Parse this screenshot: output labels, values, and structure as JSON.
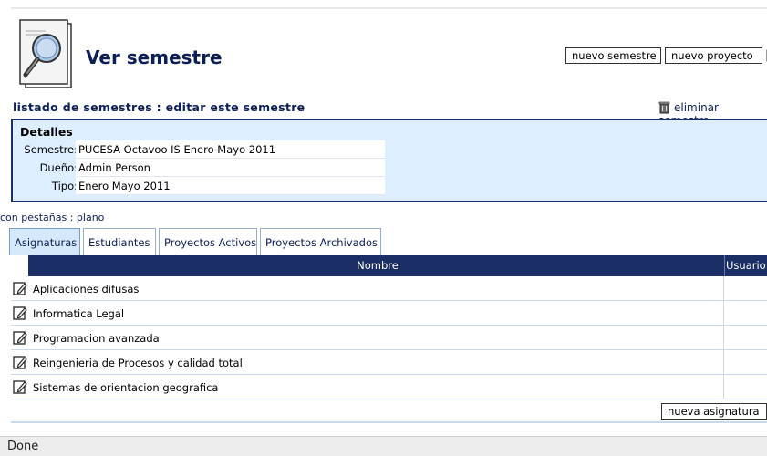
{
  "header": {
    "title": "Ver semestre",
    "icon": "document-magnifier-icon",
    "buttons": {
      "new_semester": "nuevo semestre",
      "new_project": "nuevo proyecto"
    }
  },
  "nav": {
    "breadcrumb": "listado de semestres : editar este semestre",
    "delete_link": "eliminar semestre"
  },
  "details": {
    "title": "Detalles",
    "rows": [
      {
        "label": "Semestre:",
        "value": "PUCESA Octavoo IS Enero Mayo 2011"
      },
      {
        "label": "Dueño:",
        "value": "Admin Person"
      },
      {
        "label": "Tipo:",
        "value": "Enero Mayo 2011"
      }
    ]
  },
  "tabs": {
    "caption": "con pestañas : plano",
    "items": [
      {
        "label": "Asignaturas",
        "active": true
      },
      {
        "label": "Estudiantes",
        "active": false
      },
      {
        "label": "Proyectos Activos",
        "active": false
      },
      {
        "label": "Proyectos Archivados",
        "active": false
      }
    ]
  },
  "table": {
    "columns": [
      "Nombre",
      "Usuario"
    ],
    "rows": [
      {
        "name": "Aplicaciones difusas"
      },
      {
        "name": "Informatica Legal"
      },
      {
        "name": "Programacion avanzada"
      },
      {
        "name": "Reingenieria de Procesos y calidad total"
      },
      {
        "name": "Sistemas de orientacion geografica"
      }
    ],
    "add_button": "nueva asignatura"
  },
  "status": {
    "text": "Done"
  },
  "colors": {
    "navy": "#1b2f66",
    "details_bg": "#dceeff",
    "link": "#0c1f57"
  }
}
